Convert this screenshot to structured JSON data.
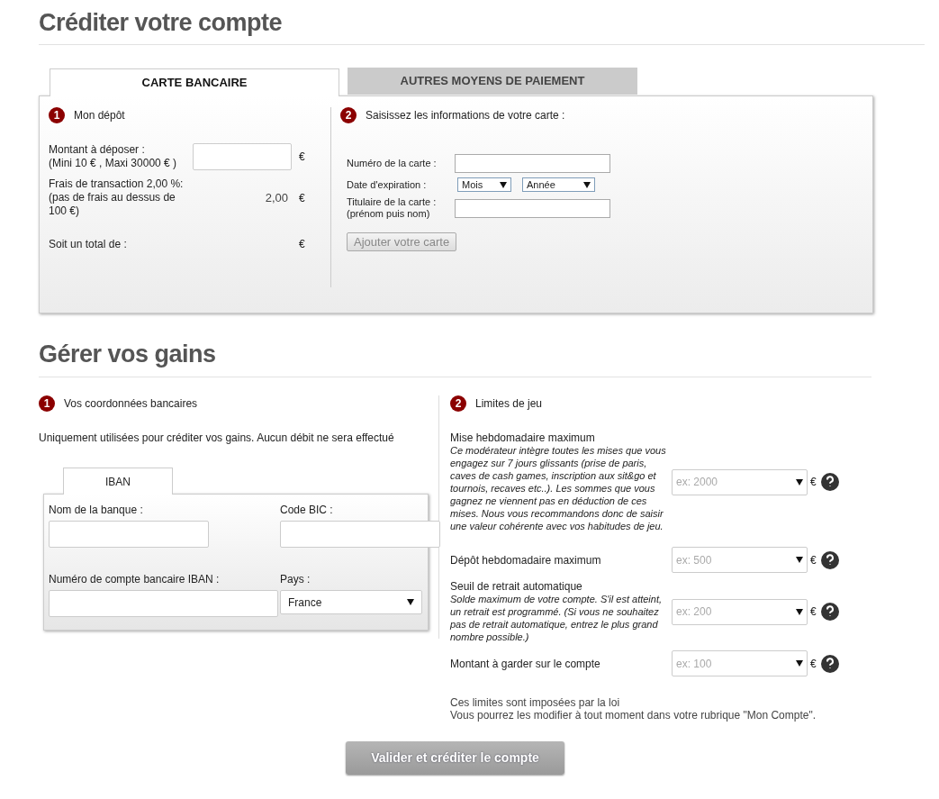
{
  "deposit": {
    "title": "Créditer votre compte",
    "tabs": [
      {
        "label": "CARTE BANCAIRE",
        "selected": true
      },
      {
        "label": "AUTRES MOYENS DE PAIEMENT",
        "selected": false
      }
    ],
    "step1": {
      "number": "1",
      "title": "Mon dépôt"
    },
    "rows": [
      {
        "kind": "input",
        "lines": [
          "Montant à déposer :",
          "(Mini 10 € , Maxi 30000 € )"
        ],
        "currency": "€"
      },
      {
        "kind": "value",
        "lines": [
          "Frais de transaction 2,00 %: (pas de frais au dessus de 100 €)"
        ],
        "value": "2,00",
        "currency": "€"
      },
      {
        "kind": "value",
        "lines": [
          "Soit un total de :"
        ],
        "currency": "€"
      }
    ],
    "step2": {
      "number": "2",
      "title": "Saisissez les informations de votre carte :"
    },
    "card_fields": [
      {
        "kind": "text",
        "lines": [
          "Numéro de la carte :"
        ]
      },
      {
        "kind": "expiry",
        "lines": [
          "Date d'expiration :"
        ],
        "selects": [
          "Mois",
          "Année"
        ]
      },
      {
        "kind": "text",
        "lines": [
          "Titulaire de la carte :",
          "(prénom puis nom)"
        ]
      }
    ],
    "add_card_button": "Ajouter votre carte"
  },
  "gains": {
    "title": "Gérer vos gains",
    "step1": {
      "number": "1",
      "title": "Vos coordonnées bancaires"
    },
    "intro": "Uniquement utilisées pour créditer vos gains. Aucun débit ne sera effectué",
    "tabs": [
      {
        "label": "IBAN",
        "selected": true
      }
    ],
    "bank_fields": [
      {
        "kind": "text",
        "label": "Nom de la banque :"
      },
      {
        "kind": "text",
        "label": "Code BIC :"
      },
      {
        "kind": "text",
        "label": "Numéro de compte bancaire IBAN :"
      },
      {
        "kind": "select",
        "label": "Pays :",
        "value": "France"
      }
    ],
    "step2": {
      "number": "2",
      "title": "Limites de jeu"
    },
    "limits": [
      {
        "label": "Mise hebdomadaire maximum",
        "description": "Ce modérateur intègre toutes les mises que vous engagez sur 7 jours glissants (prise de paris, caves de cash games, inscription aux sit&go et tournois, recaves etc..). Les sommes que vous gagnez ne viennent pas en déduction de ces mises. Nous vous recommandons donc de saisir une valeur cohérente avec vos habitudes de jeu.",
        "placeholder": "ex: 2000",
        "currency": "€"
      },
      {
        "label": "Dépôt hebdomadaire maximum",
        "placeholder": "ex: 500",
        "currency": "€"
      },
      {
        "label": "Seuil de retrait automatique",
        "description": "Solde maximum de votre compte. S'il est atteint, un retrait est programmé. (Si vous ne souhaitez pas de retrait automatique, entrez le plus grand nombre possible.)",
        "placeholder": "ex: 200",
        "currency": "€"
      },
      {
        "label": "Montant à garder sur le compte",
        "placeholder": "ex: 100",
        "currency": "€"
      }
    ],
    "notes": [
      "Ces limites sont imposées par la loi",
      "Vous pourrez les modifier à tout moment dans votre rubrique \"Mon Compte\"."
    ]
  },
  "submit_button": "Valider et créditer le compte"
}
